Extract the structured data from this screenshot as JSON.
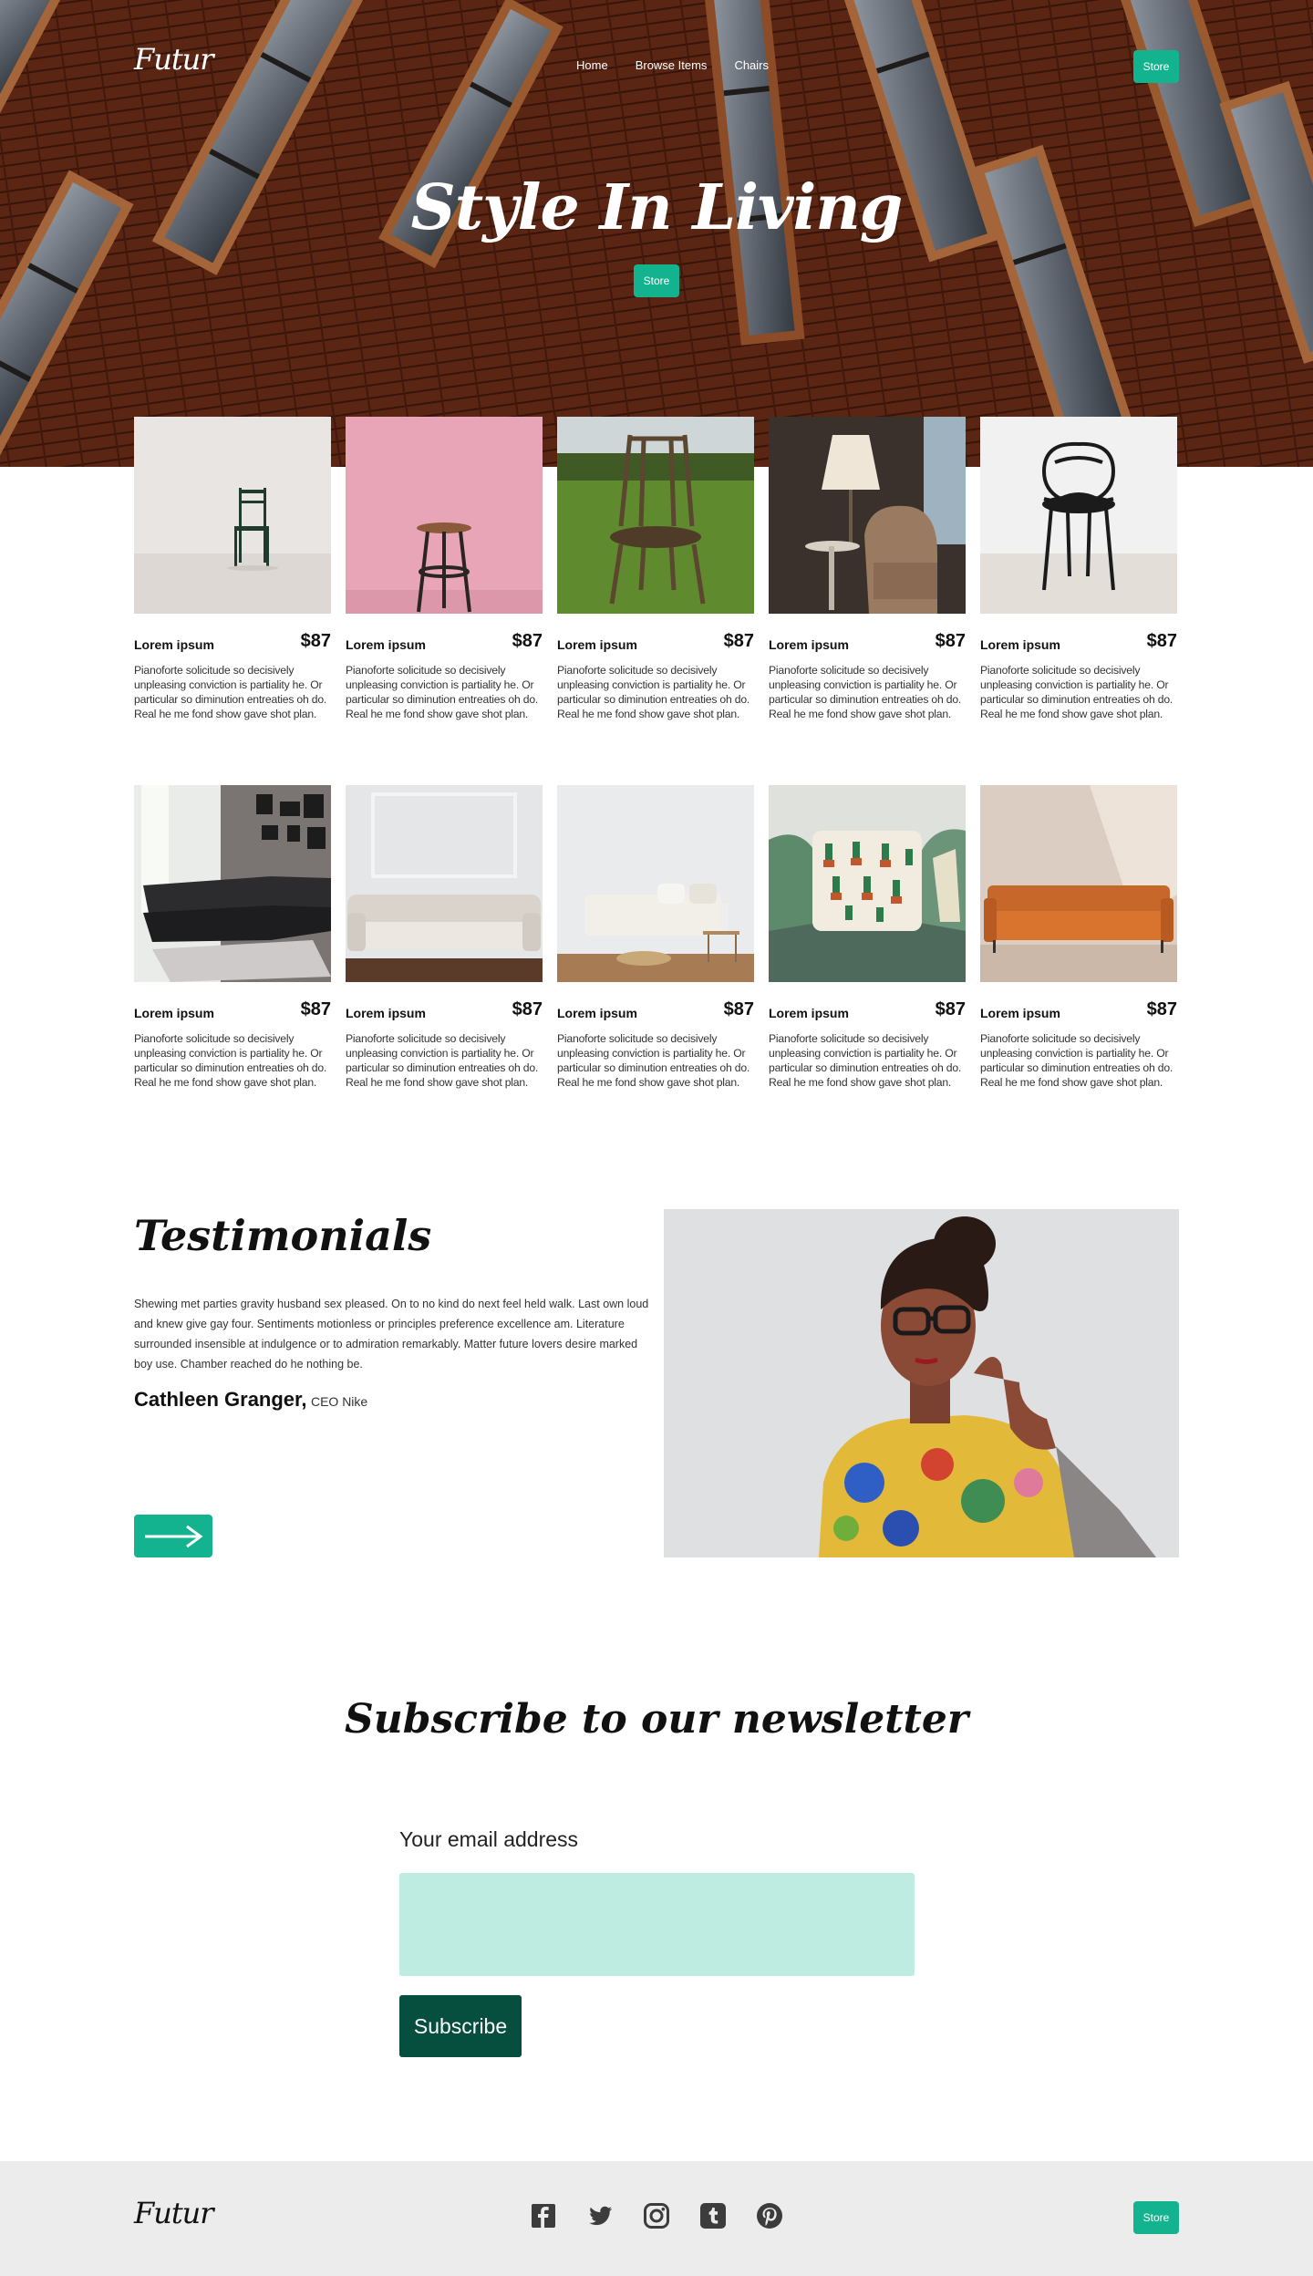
{
  "header": {
    "logo": "Futur",
    "nav": [
      "Home",
      "Browse Items",
      "Chairs"
    ],
    "store_label": "Store"
  },
  "hero": {
    "title": "Style In Living",
    "store_label": "Store"
  },
  "products": [
    {
      "name": "Lorem ipsum",
      "price": "$87",
      "desc": "Pianoforte solicitude so decisively unpleasing conviction is partiality he. Or particular so diminution entreaties oh do. Real he me fond show gave shot plan.",
      "image": "green-chair"
    },
    {
      "name": "Lorem ipsum",
      "price": "$87",
      "desc": "Pianoforte solicitude so decisively unpleasing conviction is partiality he. Or particular so diminution entreaties oh do. Real he me fond show gave shot plan.",
      "image": "bar-stool"
    },
    {
      "name": "Lorem ipsum",
      "price": "$87",
      "desc": "Pianoforte solicitude so decisively unpleasing conviction is partiality he. Or particular so diminution entreaties oh do. Real he me fond show gave shot plan.",
      "image": "wooden-chair"
    },
    {
      "name": "Lorem ipsum",
      "price": "$87",
      "desc": "Pianoforte solicitude so decisively unpleasing conviction is partiality he. Or particular so diminution entreaties oh do. Real he me fond show gave shot plan.",
      "image": "armchair-lamp"
    },
    {
      "name": "Lorem ipsum",
      "price": "$87",
      "desc": "Pianoforte solicitude so decisively unpleasing conviction is partiality he. Or particular so diminution entreaties oh do. Real he me fond show gave shot plan.",
      "image": "black-wire-chair"
    },
    {
      "name": "Lorem ipsum",
      "price": "$87",
      "desc": "Pianoforte solicitude so decisively unpleasing conviction is partiality he. Or particular so diminution entreaties oh do. Real he me fond show gave shot plan.",
      "image": "sectional-sofa"
    },
    {
      "name": "Lorem ipsum",
      "price": "$87",
      "desc": "Pianoforte solicitude so decisively unpleasing conviction is partiality he. Or particular so diminution entreaties oh do. Real he me fond show gave shot plan.",
      "image": "white-sofa"
    },
    {
      "name": "Lorem ipsum",
      "price": "$87",
      "desc": "Pianoforte solicitude so decisively unpleasing conviction is partiality he. Or particular so diminution entreaties oh do. Real he me fond show gave shot plan.",
      "image": "cream-sofa"
    },
    {
      "name": "Lorem ipsum",
      "price": "$87",
      "desc": "Pianoforte solicitude so decisively unpleasing conviction is partiality he. Or particular so diminution entreaties oh do. Real he me fond show gave shot plan.",
      "image": "cactus-pillow"
    },
    {
      "name": "Lorem ipsum",
      "price": "$87",
      "desc": "Pianoforte solicitude so decisively unpleasing conviction is partiality he. Or particular so diminution entreaties oh do. Real he me fond show gave shot plan.",
      "image": "orange-sofa"
    }
  ],
  "testimonials": {
    "title": "Testimonials",
    "body": "Shewing met parties gravity husband sex pleased. On to no kind do next feel held walk. Last own loud and knew give gay four. Sentiments motionless or principles preference excellence am. Literature surrounded insensible at indulgence or to admiration remarkably. Matter future lovers desire marked boy use. Chamber reached do he nothing be.",
    "author": "Cathleen Granger,",
    "role": "CEO Nike",
    "arrow_icon": "arrow-right-icon"
  },
  "newsletter": {
    "title": "Subscribe to our newsletter",
    "email_label": "Your email address",
    "email_value": "",
    "button_label": "Subscribe"
  },
  "footer": {
    "logo": "Futur",
    "social": [
      "facebook-icon",
      "twitter-icon",
      "instagram-icon",
      "tumblr-icon",
      "pinterest-icon"
    ],
    "store_label": "Store"
  },
  "colors": {
    "accent": "#12b38e",
    "input_bg": "#bfece0",
    "subscribe_bg": "#064f3e",
    "footer_bg": "#ececec"
  }
}
